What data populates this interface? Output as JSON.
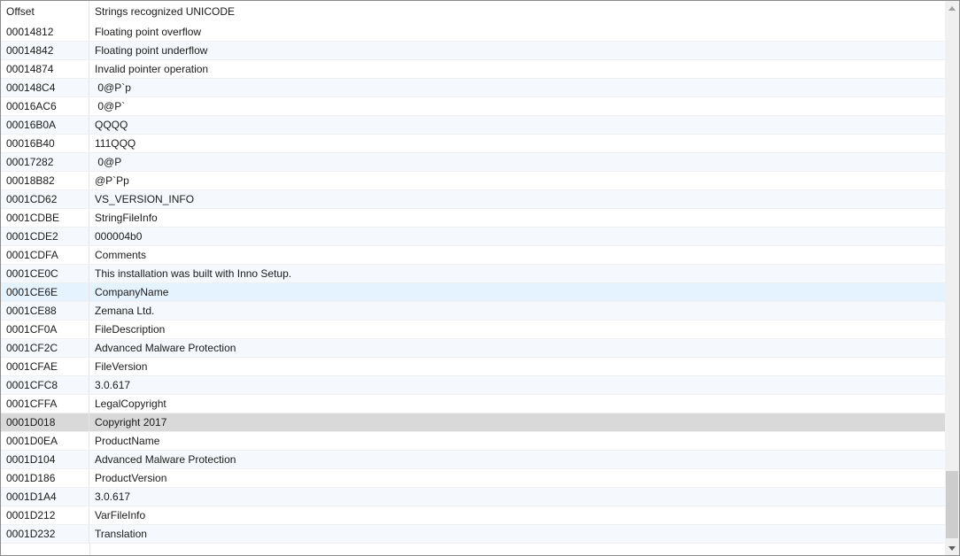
{
  "table": {
    "columns": [
      "Offset",
      "Strings recognized UNICODE"
    ],
    "rows": [
      {
        "offset": "00014812",
        "string": "Floating point overflow"
      },
      {
        "offset": "00014842",
        "string": "Floating point underflow"
      },
      {
        "offset": "00014874",
        "string": "Invalid pointer operation"
      },
      {
        "offset": "000148C4",
        "string": " 0@P`p"
      },
      {
        "offset": "00016AC6",
        "string": " 0@P`"
      },
      {
        "offset": "00016B0A",
        "string": "QQQQ"
      },
      {
        "offset": "00016B40",
        "string": "111QQQ"
      },
      {
        "offset": "00017282",
        "string": " 0@P"
      },
      {
        "offset": "00018B82",
        "string": "@P`Pp"
      },
      {
        "offset": "0001CD62",
        "string": "VS_VERSION_INFO"
      },
      {
        "offset": "0001CDBE",
        "string": "StringFileInfo"
      },
      {
        "offset": "0001CDE2",
        "string": "000004b0"
      },
      {
        "offset": "0001CDFA",
        "string": "Comments"
      },
      {
        "offset": "0001CE0C",
        "string": "This installation was built with Inno Setup."
      },
      {
        "offset": "0001CE6E",
        "string": "CompanyName"
      },
      {
        "offset": "0001CE88",
        "string": "Zemana Ltd."
      },
      {
        "offset": "0001CF0A",
        "string": "FileDescription"
      },
      {
        "offset": "0001CF2C",
        "string": "Advanced Malware Protection"
      },
      {
        "offset": "0001CFAE",
        "string": "FileVersion"
      },
      {
        "offset": "0001CFC8",
        "string": "3.0.617"
      },
      {
        "offset": "0001CFFA",
        "string": "LegalCopyright"
      },
      {
        "offset": "0001D018",
        "string": "Copyright 2017"
      },
      {
        "offset": "0001D0EA",
        "string": "ProductName"
      },
      {
        "offset": "0001D104",
        "string": "Advanced Malware Protection"
      },
      {
        "offset": "0001D186",
        "string": "ProductVersion"
      },
      {
        "offset": "0001D1A4",
        "string": "3.0.617"
      },
      {
        "offset": "0001D212",
        "string": "VarFileInfo"
      },
      {
        "offset": "0001D232",
        "string": "Translation"
      }
    ],
    "hover_row": 14,
    "selected_row": 21
  },
  "scrollbar": {
    "up_icon": "scroll-up-arrow-icon",
    "down_icon": "scroll-down-arrow-icon"
  },
  "colors": {
    "selected": "#d9d9d9",
    "hover": "#e5f3ff",
    "scroll_thumb": "#cdcdcd"
  }
}
